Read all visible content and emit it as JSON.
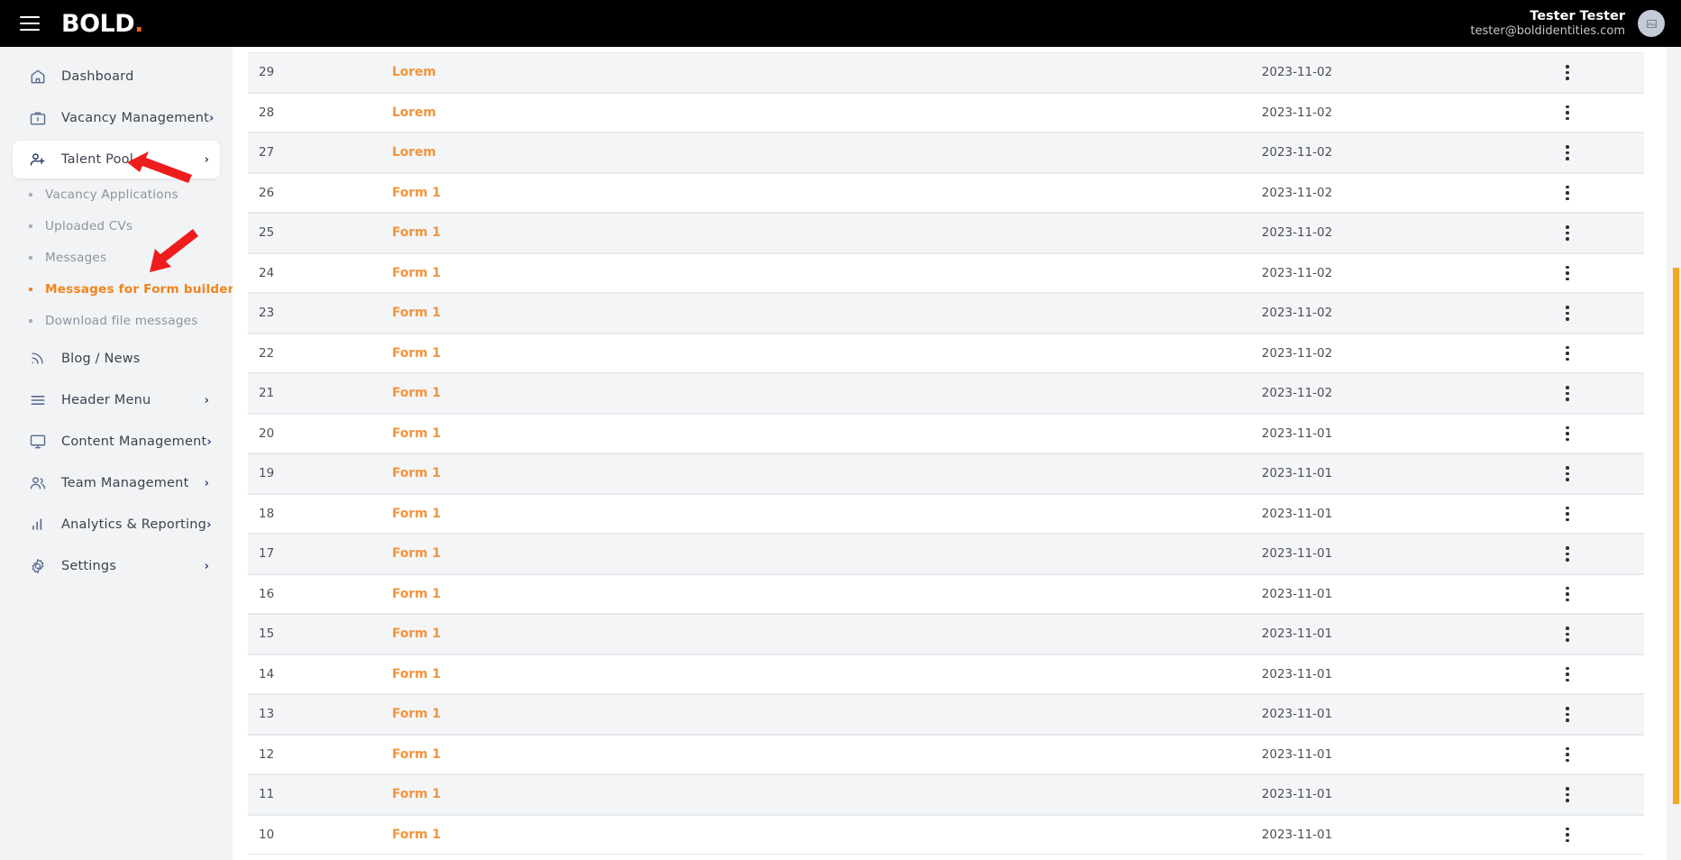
{
  "topbar": {
    "menu_icon": "hamburger-menu-icon",
    "brand": "BOLD",
    "brand_dot": ".",
    "user_name": "Tester Tester",
    "user_email": "tester@boldidentities.com",
    "avatar_alt": "broken-image-icon",
    "accent_color": "#f2641e",
    "background_color": "#000000"
  },
  "sidebar": {
    "background_color": "#f1f3f5",
    "active_color": "#f2841c",
    "items": [
      {
        "label": "Dashboard",
        "icon": "home-icon",
        "expandable": false,
        "active": false
      },
      {
        "label": "Vacancy Management",
        "icon": "briefcase-icon",
        "expandable": true,
        "active": false
      },
      {
        "label": "Talent Pool",
        "icon": "user-plus-icon",
        "expandable": true,
        "active": true
      },
      {
        "label": "Blog / News",
        "icon": "rss-icon",
        "expandable": false,
        "active": false
      },
      {
        "label": "Header Menu",
        "icon": "menu-lines-icon",
        "expandable": true,
        "active": false
      },
      {
        "label": "Content Management",
        "icon": "monitor-icon",
        "expandable": true,
        "active": false
      },
      {
        "label": "Team Management",
        "icon": "users-icon",
        "expandable": true,
        "active": false
      },
      {
        "label": "Analytics & Reporting",
        "icon": "bar-chart-icon",
        "expandable": true,
        "active": false
      },
      {
        "label": "Settings",
        "icon": "gear-icon",
        "expandable": true,
        "active": false
      }
    ],
    "sub_items": [
      {
        "label": "Vacancy Applications",
        "active": false
      },
      {
        "label": "Uploaded CVs",
        "active": false
      },
      {
        "label": "Messages",
        "active": false
      },
      {
        "label": "Messages for Form builder",
        "active": true
      },
      {
        "label": "Download file messages",
        "active": false
      }
    ]
  },
  "table": {
    "row_menu_icon": "kebab-menu-icon",
    "link_color": "#f2943c",
    "rows": [
      {
        "id": "29",
        "name": "Lorem",
        "date": "2023-11-02"
      },
      {
        "id": "28",
        "name": "Lorem",
        "date": "2023-11-02"
      },
      {
        "id": "27",
        "name": "Lorem",
        "date": "2023-11-02"
      },
      {
        "id": "26",
        "name": "Form 1",
        "date": "2023-11-02"
      },
      {
        "id": "25",
        "name": "Form 1",
        "date": "2023-11-02"
      },
      {
        "id": "24",
        "name": "Form 1",
        "date": "2023-11-02"
      },
      {
        "id": "23",
        "name": "Form 1",
        "date": "2023-11-02"
      },
      {
        "id": "22",
        "name": "Form 1",
        "date": "2023-11-02"
      },
      {
        "id": "21",
        "name": "Form 1",
        "date": "2023-11-02"
      },
      {
        "id": "20",
        "name": "Form 1",
        "date": "2023-11-01"
      },
      {
        "id": "19",
        "name": "Form 1",
        "date": "2023-11-01"
      },
      {
        "id": "18",
        "name": "Form 1",
        "date": "2023-11-01"
      },
      {
        "id": "17",
        "name": "Form 1",
        "date": "2023-11-01"
      },
      {
        "id": "16",
        "name": "Form 1",
        "date": "2023-11-01"
      },
      {
        "id": "15",
        "name": "Form 1",
        "date": "2023-11-01"
      },
      {
        "id": "14",
        "name": "Form 1",
        "date": "2023-11-01"
      },
      {
        "id": "13",
        "name": "Form 1",
        "date": "2023-11-01"
      },
      {
        "id": "12",
        "name": "Form 1",
        "date": "2023-11-01"
      },
      {
        "id": "11",
        "name": "Form 1",
        "date": "2023-11-01"
      },
      {
        "id": "10",
        "name": "Form 1",
        "date": "2023-11-01"
      }
    ]
  },
  "scrollbar": {
    "thumb_color": "#f5a623"
  },
  "annotations": [
    {
      "name": "arrow-pointing-talent-pool",
      "color": "#ee1c1c"
    },
    {
      "name": "arrow-pointing-messages-for-form-builder",
      "color": "#ee1c1c"
    }
  ]
}
